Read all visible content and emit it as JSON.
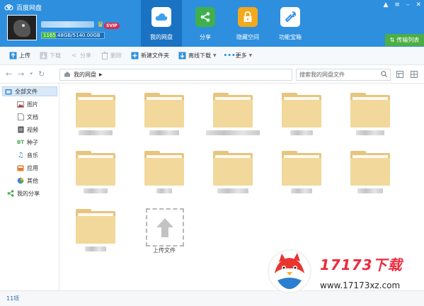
{
  "app": {
    "title": "百度网盘"
  },
  "account": {
    "storage_text": "1165.48GB/5140.00GB",
    "storage_fraction": 0.227,
    "badge": "SVIP"
  },
  "nav_tabs": [
    {
      "label": "我的网盘",
      "icon": "cloud-icon",
      "color": "#3ba0ef",
      "active": true
    },
    {
      "label": "分享",
      "icon": "share-icon",
      "color": "#3fb04d",
      "active": false
    },
    {
      "label": "隐藏空间",
      "icon": "lock-icon",
      "color": "#f2a91c",
      "active": false
    },
    {
      "label": "功能宝箱",
      "icon": "wrench-icon",
      "color": "#3a93e6",
      "active": false
    }
  ],
  "window_controls": {
    "pin": "▲",
    "menu": "≡",
    "minimize": "–",
    "close": "✕"
  },
  "transfer_list": {
    "label": "传输列表"
  },
  "toolbar": {
    "upload": "上传",
    "download": "下载",
    "share": "分享",
    "delete": "删除",
    "new_folder": "新建文件夹",
    "offline_download": "离线下载",
    "more": "更多"
  },
  "address": {
    "path": "我的网盘",
    "search_placeholder": "搜索我的网盘文件"
  },
  "sidebar": {
    "all_files": "全部文件",
    "items": [
      {
        "label": "图片",
        "icon": "image-icon"
      },
      {
        "label": "文档",
        "icon": "document-icon"
      },
      {
        "label": "视频",
        "icon": "video-icon"
      },
      {
        "label": "种子",
        "icon": "bt-icon"
      },
      {
        "label": "音乐",
        "icon": "music-icon"
      },
      {
        "label": "应用",
        "icon": "app-icon"
      },
      {
        "label": "其他",
        "icon": "other-icon"
      }
    ],
    "my_share": "我的分享"
  },
  "upload_tile": {
    "label": "上传文件"
  },
  "status": {
    "item_count": "11项"
  },
  "watermark": {
    "brand": "17173下载",
    "url": "www.17173xz.com"
  }
}
